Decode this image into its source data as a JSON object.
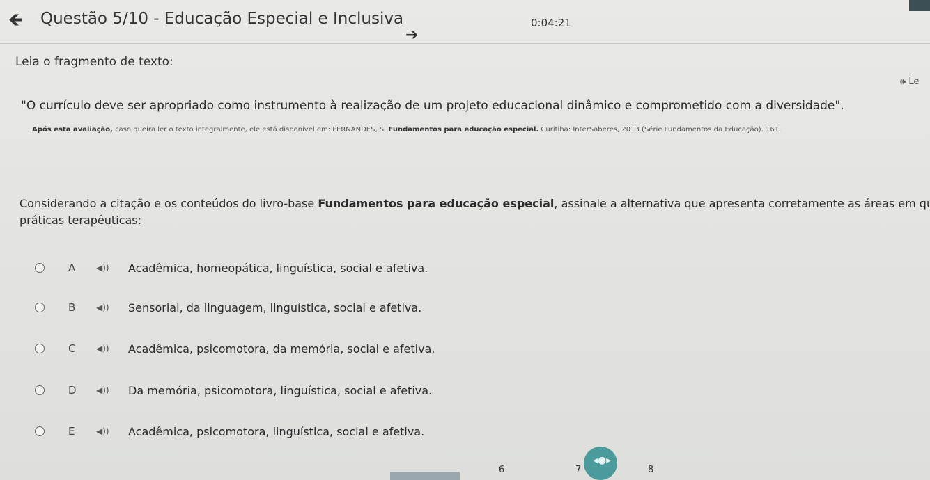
{
  "header": {
    "title": "Questão 5/10 - Educação Especial e Inclusiva",
    "back_icon": "arrow-left-icon",
    "next_icon": "arrow-right-icon",
    "timer": "0:04:21"
  },
  "content": {
    "read_label": "Leia o fragmento de texto:",
    "listen_label": "🕪 Le",
    "quote": "\"O currículo deve ser apropriado como instrumento à realização de um projeto educacional dinâmico e comprometido com a diversidade\".",
    "source_bold": "Após esta avaliação,",
    "source_text": " caso queira ler o texto integralmente, ele está disponível em: FERNANDES, S. ",
    "source_book": "Fundamentos para educação especial.",
    "source_tail": " Curitiba: InterSaberes, 2013 (Série Fundamentos da Educação). 161.",
    "question_start": "Considerando a citação e os conteúdos do livro-base ",
    "question_book": "Fundamentos para educação especial",
    "question_end": ", assinale a alternativa que apresenta corretamente as áreas em que são enfatizadas",
    "question_line2": "práticas terapêuticas:"
  },
  "options": [
    {
      "letter": "A",
      "text": "Acadêmica, homeopática, linguística, social e afetiva."
    },
    {
      "letter": "B",
      "text": "Sensorial, da linguagem, linguística, social e afetiva."
    },
    {
      "letter": "C",
      "text": "Acadêmica, psicomotora, da memória, social e afetiva."
    },
    {
      "letter": "D",
      "text": "Da memória, psicomotora, linguística, social e afetiva."
    },
    {
      "letter": "E",
      "text": "Acadêmica, psicomotora, linguística, social e afetiva."
    }
  ],
  "pager": {
    "pages": [
      "6",
      "7",
      "8"
    ],
    "nav_icon": "direction-pad-icon"
  }
}
